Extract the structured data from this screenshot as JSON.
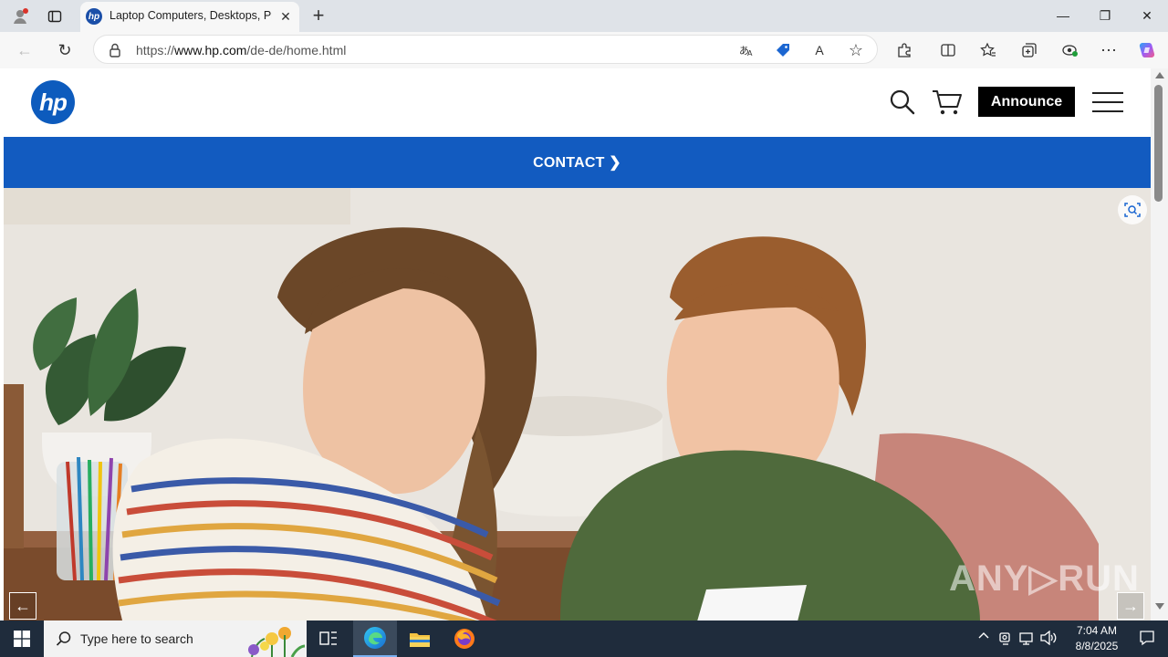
{
  "browser": {
    "tab": {
      "title": "Laptop Computers, Desktops, Printers, Ink & Toner | HP® Official Store",
      "favicon_text": "hp"
    },
    "window_controls": {
      "minimize": "—",
      "restore": "❐",
      "close": "✕"
    },
    "address": {
      "url_prefix": "https://",
      "url_host": "www.hp.com",
      "url_path": "/de-de/home.html"
    },
    "icons": {
      "new_tab": "+",
      "back": "←",
      "reload": "↻",
      "read_aloud": "A",
      "favorite": "☆",
      "settings_more": "⋯"
    }
  },
  "site": {
    "logo_text": "hp",
    "announce_label": "Announce",
    "promo_label": "CONTACT ❯",
    "carousel_prev": "←",
    "carousel_next": "→",
    "watermark": "ANY▷RUN",
    "brand_color": "#125bc0"
  },
  "taskbar": {
    "search_placeholder": "Type here to search",
    "time": "7:04 AM",
    "date": "8/8/2025"
  }
}
